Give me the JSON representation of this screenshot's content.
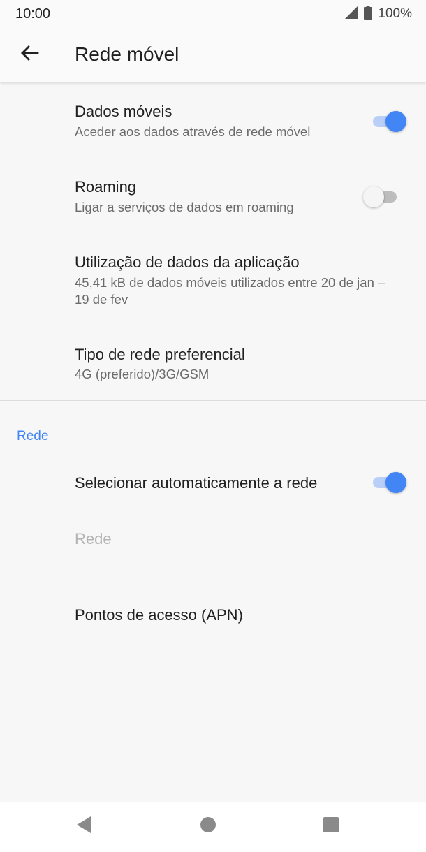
{
  "status_bar": {
    "time": "10:00",
    "battery": "100%"
  },
  "app_bar": {
    "title": "Rede móvel"
  },
  "settings": {
    "mobile_data": {
      "title": "Dados móveis",
      "subtitle": "Aceder aos dados através de rede móvel",
      "enabled": true
    },
    "roaming": {
      "title": "Roaming",
      "subtitle": "Ligar a serviços de dados em roaming",
      "enabled": false
    },
    "app_data_usage": {
      "title": "Utilização de dados da aplicação",
      "subtitle": "45,41 kB de dados móveis utilizados entre 20 de jan – 19 de fev"
    },
    "preferred_network": {
      "title": "Tipo de rede preferencial",
      "subtitle": "4G (preferido)/3G/GSM"
    }
  },
  "network_section": {
    "header": "Rede",
    "auto_select": {
      "title": "Selecionar automaticamente a rede",
      "enabled": true
    },
    "network": {
      "title": "Rede"
    }
  },
  "apn": {
    "title": "Pontos de acesso (APN)"
  },
  "colors": {
    "accent": "#4285f4",
    "disabled_text": "#b4b4b4"
  }
}
